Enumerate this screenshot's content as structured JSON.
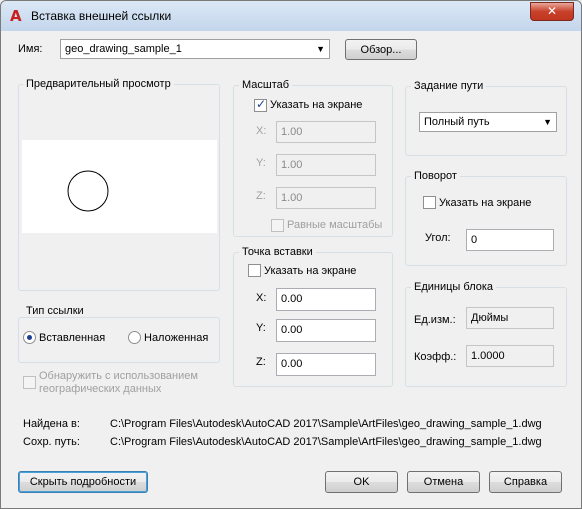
{
  "window": {
    "title": "Вставка внешней ссылки",
    "close": "✕"
  },
  "name": {
    "label": "Имя:",
    "value": "geo_drawing_sample_1",
    "browse": "Обзор..."
  },
  "preview": {
    "title": "Предварительный просмотр"
  },
  "scale": {
    "title": "Масштаб",
    "specify": "Указать на экране",
    "specify_checked": true,
    "x_label": "X:",
    "x": "1.00",
    "y_label": "Y:",
    "y": "1.00",
    "z_label": "Z:",
    "z": "1.00",
    "uniform": "Равные масштабы"
  },
  "path": {
    "title": "Задание пути",
    "value": "Полный путь"
  },
  "rotation": {
    "title": "Поворот",
    "specify": "Указать на экране",
    "angle_label": "Угол:",
    "angle": "0"
  },
  "ref_type": {
    "title": "Тип ссылки",
    "attach": "Вставленная",
    "overlay": "Наложенная",
    "selected": "attach"
  },
  "insertion": {
    "title": "Точка вставки",
    "specify": "Указать на экране",
    "x_label": "X:",
    "x": "0.00",
    "y_label": "Y:",
    "y": "0.00",
    "z_label": "Z:",
    "z": "0.00"
  },
  "block_units": {
    "title": "Единицы блока",
    "unit_label": "Ед.изм.:",
    "unit": "Дюймы",
    "factor_label": "Коэфф.:",
    "factor": "1.0000"
  },
  "geo": {
    "line1": "Обнаружить с использованием",
    "line2": "географических данных"
  },
  "found": {
    "label": "Найдена в:",
    "value": "C:\\Program Files\\Autodesk\\AutoCAD 2017\\Sample\\ArtFiles\\geo_drawing_sample_1.dwg"
  },
  "saved": {
    "label": "Сохр. путь:",
    "value": "C:\\Program Files\\Autodesk\\AutoCAD 2017\\Sample\\ArtFiles\\geo_drawing_sample_1.dwg"
  },
  "buttons": {
    "details": "Скрыть подробности",
    "ok": "OK",
    "cancel": "Отмена",
    "help": "Справка"
  }
}
